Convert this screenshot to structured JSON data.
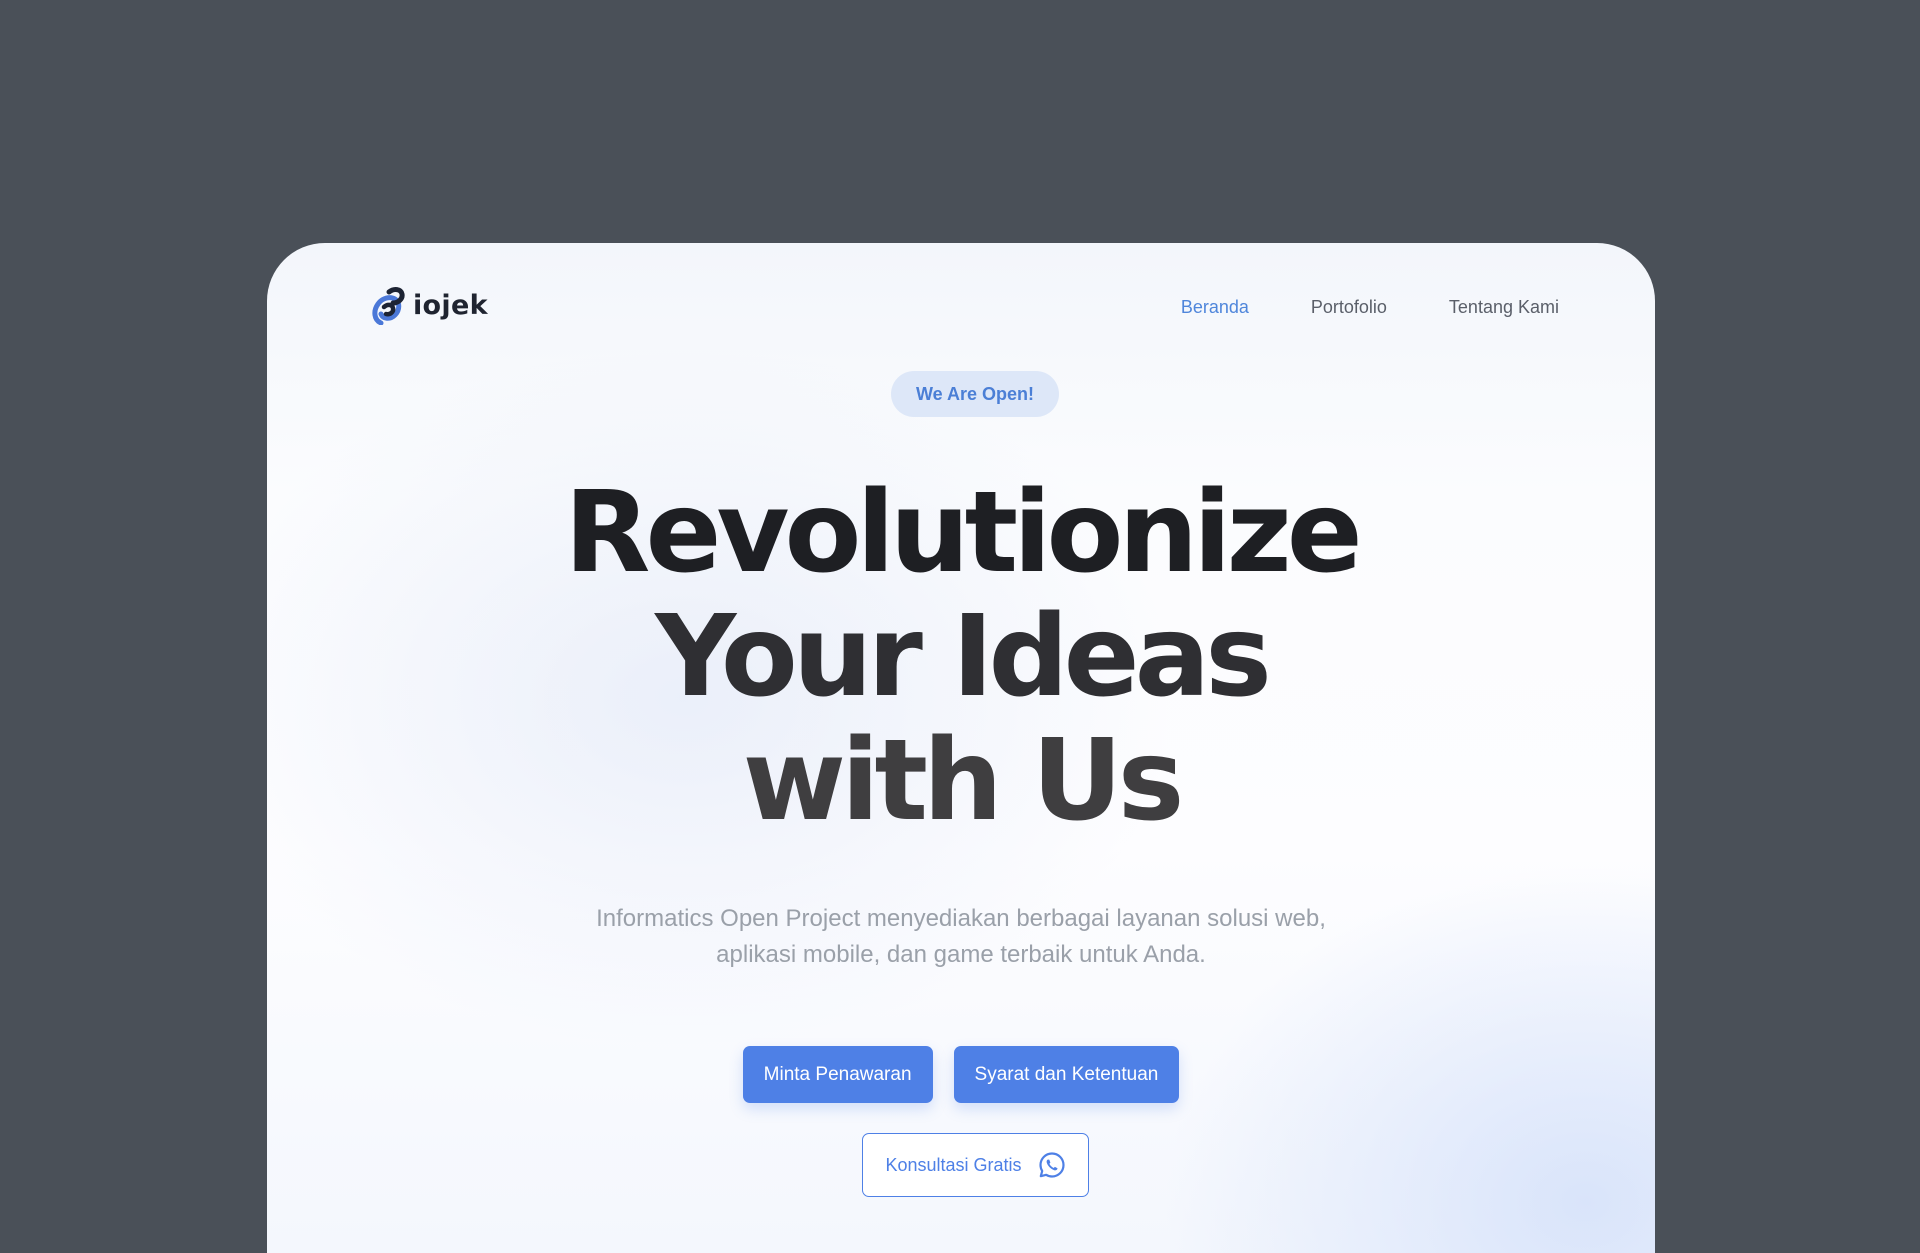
{
  "header": {
    "brand": "iojek",
    "nav": [
      {
        "label": "Beranda",
        "active": true
      },
      {
        "label": "Portofolio",
        "active": false
      },
      {
        "label": "Tentang Kami",
        "active": false
      }
    ]
  },
  "hero": {
    "badge": "We Are Open!",
    "title_lines": [
      "Revolutionize",
      "Your Ideas",
      "with Us"
    ],
    "subtitle": "Informatics Open Project menyediakan berbagai layanan solusi web, aplikasi mobile, dan game terbaik untuk Anda.",
    "primary_buttons": [
      "Minta Penawaran",
      "Syarat dan Ketentuan"
    ],
    "secondary_button": {
      "label": "Konsultasi Gratis",
      "icon": "whatsapp-icon"
    }
  },
  "colors": {
    "accent": "#4e80e6",
    "nav_active": "#4f86db",
    "badge_bg": "#dde7f8",
    "page_backdrop": "#4a5058"
  }
}
